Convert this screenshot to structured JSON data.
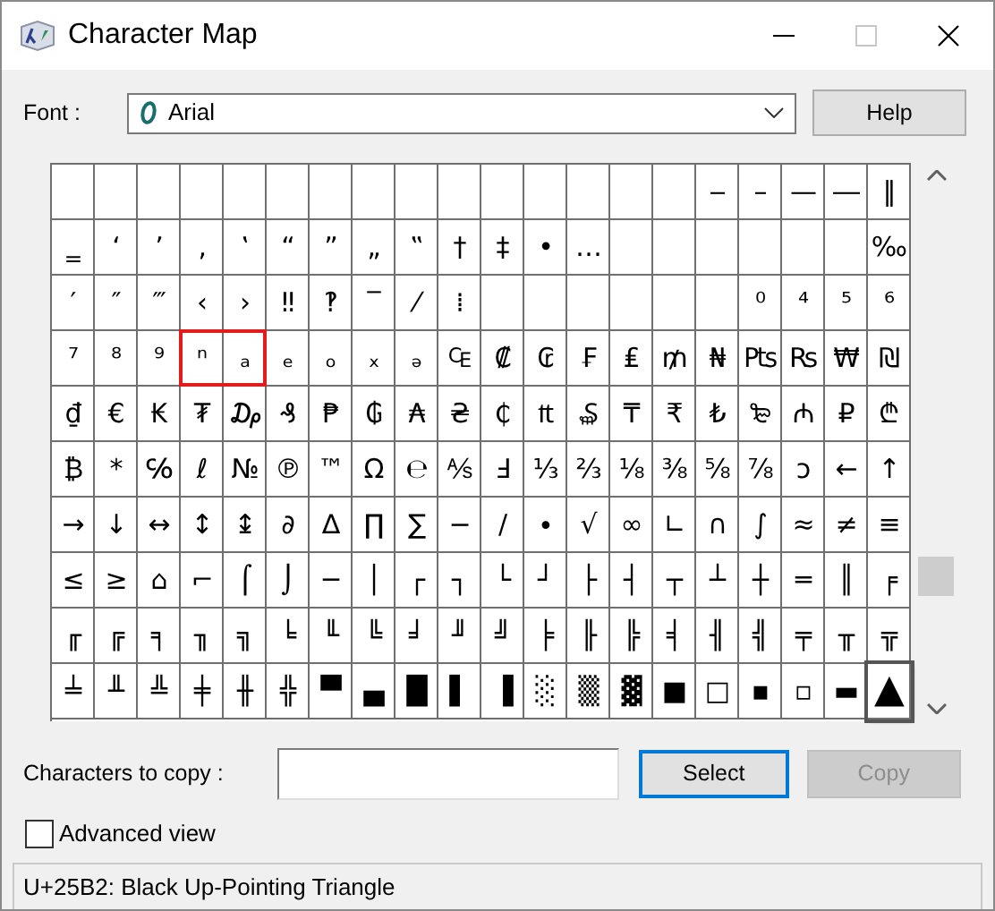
{
  "window": {
    "title": "Character Map",
    "maximize_disabled": true
  },
  "font": {
    "label": "Font :",
    "value": "Arial",
    "help_button": "Help"
  },
  "grid": {
    "rows": [
      [
        {
          "selected": false
        },
        {
          "selected": false
        },
        {
          "selected": false
        },
        {
          "selected": false
        },
        {
          "selected": false
        },
        {
          "selected": false
        },
        {
          "selected": false
        },
        {
          "selected": false
        },
        {
          "selected": false
        },
        {
          "selected": false
        },
        {
          "selected": false
        },
        {
          "selected": false
        },
        {
          "selected": false
        },
        {
          "selected": false
        },
        {
          "selected": false
        },
        {
          "char": "‒",
          "selected": false
        },
        {
          "char": "–",
          "selected": false
        },
        {
          "char": "—",
          "selected": false
        },
        {
          "char": "―",
          "selected": false
        },
        {
          "char": "‖",
          "selected": false
        }
      ],
      [
        {
          "char": "‗",
          "selected": false
        },
        {
          "char": "‘",
          "selected": false
        },
        {
          "char": "’",
          "selected": false
        },
        {
          "char": "‚",
          "selected": false
        },
        {
          "char": "‛",
          "selected": false
        },
        {
          "char": "“",
          "selected": false
        },
        {
          "char": "”",
          "selected": false
        },
        {
          "char": "„",
          "selected": false
        },
        {
          "char": "‟",
          "selected": false
        },
        {
          "char": "†",
          "selected": false
        },
        {
          "char": "‡",
          "selected": false
        },
        {
          "char": "•",
          "selected": false
        },
        {
          "char": "…",
          "selected": false
        },
        {
          "selected": false
        },
        {
          "selected": false
        },
        {
          "selected": false
        },
        {
          "selected": false
        },
        {
          "selected": false
        },
        {
          "selected": false
        },
        {
          "char": "‰",
          "selected": false
        }
      ],
      [
        {
          "char": "′",
          "selected": false
        },
        {
          "char": "″",
          "selected": false
        },
        {
          "char": "‴",
          "selected": false
        },
        {
          "char": "‹",
          "selected": false
        },
        {
          "char": "›",
          "selected": false
        },
        {
          "char": "‼",
          "selected": false
        },
        {
          "char": "‽",
          "selected": false
        },
        {
          "char": "‾",
          "selected": false
        },
        {
          "char": "⁄",
          "selected": false
        },
        {
          "char": "⁞",
          "selected": false
        },
        {
          "selected": false
        },
        {
          "selected": false
        },
        {
          "selected": false
        },
        {
          "selected": false
        },
        {
          "selected": false
        },
        {
          "selected": false
        },
        {
          "char": "⁰",
          "selected": false
        },
        {
          "char": "⁴",
          "selected": false
        },
        {
          "char": "⁵",
          "selected": false
        },
        {
          "char": "⁶",
          "selected": false
        }
      ],
      [
        {
          "char": "⁷",
          "selected": false
        },
        {
          "char": "⁸",
          "selected": false
        },
        {
          "char": "⁹",
          "selected": false
        },
        {
          "char": "ⁿ",
          "selected": false,
          "outlined": true
        },
        {
          "char": "ₐ",
          "selected": false
        },
        {
          "char": "ₑ",
          "selected": false
        },
        {
          "char": "ₒ",
          "selected": false
        },
        {
          "char": "ₓ",
          "selected": false
        },
        {
          "char": "ₔ",
          "selected": false
        },
        {
          "char": "₠",
          "selected": false
        },
        {
          "char": "₡",
          "selected": false
        },
        {
          "char": "₢",
          "selected": false
        },
        {
          "char": "₣",
          "selected": false
        },
        {
          "char": "₤",
          "selected": false
        },
        {
          "char": "₥",
          "selected": false
        },
        {
          "char": "₦",
          "selected": false
        },
        {
          "char": "₧",
          "selected": false
        },
        {
          "char": "₨",
          "selected": false
        },
        {
          "char": "₩",
          "selected": false
        },
        {
          "char": "₪",
          "selected": false
        }
      ],
      [
        {
          "char": "₫",
          "selected": false
        },
        {
          "char": "€",
          "selected": false
        },
        {
          "char": "₭",
          "selected": false
        },
        {
          "char": "₮",
          "selected": false
        },
        {
          "char": "₯",
          "selected": false
        },
        {
          "char": "₰",
          "selected": false
        },
        {
          "char": "₱",
          "selected": false
        },
        {
          "char": "₲",
          "selected": false
        },
        {
          "char": "₳",
          "selected": false
        },
        {
          "char": "₴",
          "selected": false
        },
        {
          "char": "₵",
          "selected": false
        },
        {
          "char": "₶",
          "selected": false
        },
        {
          "char": "₷",
          "selected": false
        },
        {
          "char": "₸",
          "selected": false
        },
        {
          "char": "₹",
          "selected": false
        },
        {
          "char": "₺",
          "selected": false
        },
        {
          "char": "₻",
          "selected": false
        },
        {
          "char": "₼",
          "selected": false
        },
        {
          "char": "₽",
          "selected": false
        },
        {
          "char": "₾",
          "selected": false
        }
      ],
      [
        {
          "char": "₿",
          "selected": false
        },
        {
          "char": "*",
          "selected": false
        },
        {
          "char": "℅",
          "selected": false
        },
        {
          "char": "ℓ",
          "selected": false
        },
        {
          "char": "№",
          "selected": false
        },
        {
          "char": "℗",
          "selected": false
        },
        {
          "char": "™",
          "selected": false
        },
        {
          "char": "Ω",
          "selected": false
        },
        {
          "char": "℮",
          "selected": false
        },
        {
          "char": "⅍",
          "selected": false
        },
        {
          "char": "Ⅎ",
          "selected": false
        },
        {
          "char": "⅓",
          "selected": false
        },
        {
          "char": "⅔",
          "selected": false
        },
        {
          "char": "⅛",
          "selected": false
        },
        {
          "char": "⅜",
          "selected": false
        },
        {
          "char": "⅝",
          "selected": false
        },
        {
          "char": "⅞",
          "selected": false
        },
        {
          "char": "ↄ",
          "selected": false
        },
        {
          "char": "←",
          "selected": false
        },
        {
          "char": "↑",
          "selected": false
        }
      ],
      [
        {
          "char": "→",
          "selected": false
        },
        {
          "char": "↓",
          "selected": false
        },
        {
          "char": "↔",
          "selected": false
        },
        {
          "char": "↕",
          "selected": false
        },
        {
          "char": "↨",
          "selected": false
        },
        {
          "char": "∂",
          "selected": false
        },
        {
          "char": "∆",
          "selected": false
        },
        {
          "char": "∏",
          "selected": false
        },
        {
          "char": "∑",
          "selected": false
        },
        {
          "char": "−",
          "selected": false
        },
        {
          "char": "∕",
          "selected": false
        },
        {
          "char": "∙",
          "selected": false
        },
        {
          "char": "√",
          "selected": false
        },
        {
          "char": "∞",
          "selected": false
        },
        {
          "char": "∟",
          "selected": false
        },
        {
          "char": "∩",
          "selected": false
        },
        {
          "char": "∫",
          "selected": false
        },
        {
          "char": "≈",
          "selected": false
        },
        {
          "char": "≠",
          "selected": false
        },
        {
          "char": "≡",
          "selected": false
        }
      ],
      [
        {
          "char": "≤",
          "selected": false
        },
        {
          "char": "≥",
          "selected": false
        },
        {
          "char": "⌂",
          "selected": false
        },
        {
          "char": "⌐",
          "selected": false
        },
        {
          "char": "⌠",
          "selected": false
        },
        {
          "char": "⌡",
          "selected": false
        },
        {
          "char": "─",
          "selected": false
        },
        {
          "char": "│",
          "selected": false
        },
        {
          "char": "┌",
          "selected": false
        },
        {
          "char": "┐",
          "selected": false
        },
        {
          "char": "└",
          "selected": false
        },
        {
          "char": "┘",
          "selected": false
        },
        {
          "char": "├",
          "selected": false
        },
        {
          "char": "┤",
          "selected": false
        },
        {
          "char": "┬",
          "selected": false
        },
        {
          "char": "┴",
          "selected": false
        },
        {
          "char": "┼",
          "selected": false
        },
        {
          "char": "═",
          "selected": false
        },
        {
          "char": "║",
          "selected": false
        },
        {
          "char": "╒",
          "selected": false
        }
      ],
      [
        {
          "char": "╓",
          "selected": false
        },
        {
          "char": "╔",
          "selected": false
        },
        {
          "char": "╕",
          "selected": false
        },
        {
          "char": "╖",
          "selected": false
        },
        {
          "char": "╗",
          "selected": false
        },
        {
          "char": "╘",
          "selected": false
        },
        {
          "char": "╙",
          "selected": false
        },
        {
          "char": "╚",
          "selected": false
        },
        {
          "char": "╛",
          "selected": false
        },
        {
          "char": "╜",
          "selected": false
        },
        {
          "char": "╝",
          "selected": false
        },
        {
          "char": "╞",
          "selected": false
        },
        {
          "char": "╟",
          "selected": false
        },
        {
          "char": "╠",
          "selected": false
        },
        {
          "char": "╡",
          "selected": false
        },
        {
          "char": "╢",
          "selected": false
        },
        {
          "char": "╣",
          "selected": false
        },
        {
          "char": "╤",
          "selected": false
        },
        {
          "char": "╥",
          "selected": false
        },
        {
          "char": "╦",
          "selected": false
        }
      ],
      [
        {
          "char": "╧",
          "selected": false
        },
        {
          "char": "╨",
          "selected": false
        },
        {
          "char": "╩",
          "selected": false
        },
        {
          "char": "╪",
          "selected": false
        },
        {
          "char": "╫",
          "selected": false
        },
        {
          "char": "╬",
          "selected": false
        },
        {
          "char": "▀",
          "selected": false
        },
        {
          "char": "▄",
          "selected": false
        },
        {
          "char": "█",
          "selected": false
        },
        {
          "char": "▌",
          "selected": false
        },
        {
          "char": "▐",
          "selected": false
        },
        {
          "char": "░",
          "selected": false
        },
        {
          "char": "▒",
          "selected": false
        },
        {
          "char": "▓",
          "selected": false
        },
        {
          "char": "■",
          "selected": false
        },
        {
          "char": "□",
          "selected": false
        },
        {
          "char": "▪",
          "selected": false
        },
        {
          "char": "▫",
          "selected": false
        },
        {
          "char": "▬",
          "selected": false
        },
        {
          "char": "▲",
          "selected": true
        }
      ]
    ]
  },
  "copy": {
    "label": "Characters to copy :",
    "select_button": "Select",
    "select_focused": true,
    "copy_button": "Copy",
    "copy_disabled": true
  },
  "advanced_view": {
    "label": "Advanced view",
    "checked": false
  },
  "status_bar": "U+25B2: Black Up-Pointing Triangle"
}
